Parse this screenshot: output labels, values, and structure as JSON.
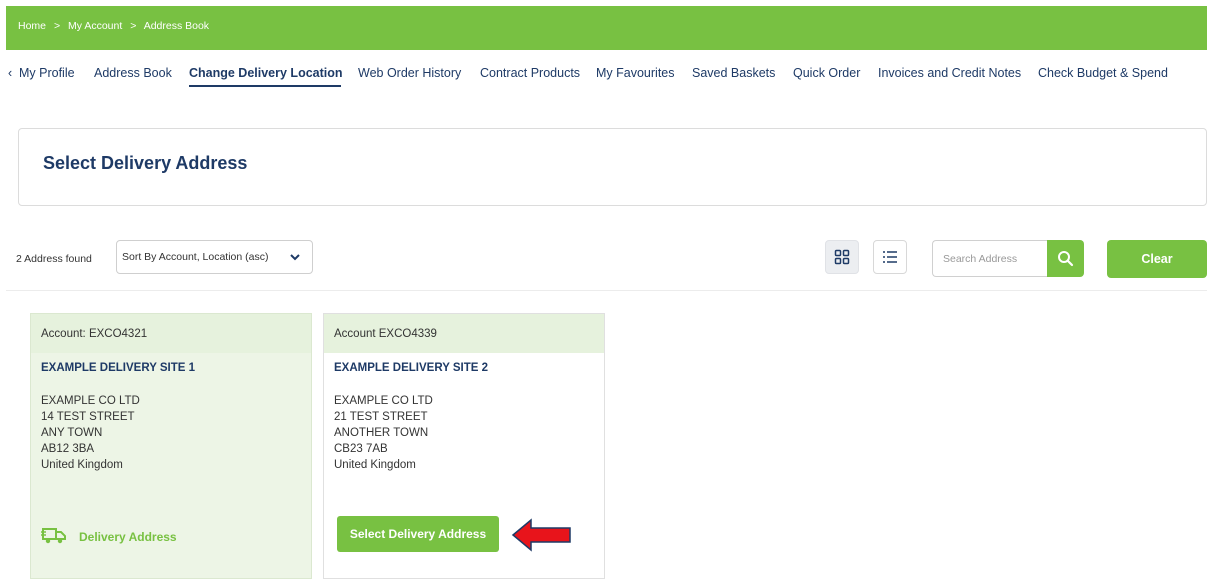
{
  "breadcrumb": {
    "items": [
      "Home",
      "My Account",
      "Address Book"
    ],
    "separator": ">"
  },
  "nav": {
    "prev_icon": "‹",
    "items": [
      "My Profile",
      "Address Book",
      "Change Delivery Location",
      "Web Order History",
      "Contract Products",
      "My Favourites",
      "Saved Baskets",
      "Quick Order",
      "Invoices and Credit Notes",
      "Check Budget & Spend"
    ],
    "active": "Change Delivery Location"
  },
  "panel": {
    "title": "Select Delivery Address"
  },
  "toolbar": {
    "count_text": "2 Address found",
    "sort_value": "Sort By Account, Location (asc)",
    "search_placeholder": "Search Address",
    "clear_label": "Clear"
  },
  "cards": [
    {
      "account": "Account:  EXCO4321",
      "site": "EXAMPLE DELIVERY SITE 1",
      "address": [
        "EXAMPLE CO LTD",
        "14 TEST STREET",
        "ANY TOWN",
        "AB12 3BA",
        "United Kingdom"
      ],
      "status": "Delivery Address"
    },
    {
      "account": "Account  EXCO4339",
      "site": "EXAMPLE DELIVERY SITE 2",
      "address": [
        "EXAMPLE CO LTD",
        "21 TEST STREET",
        "ANOTHER TOWN",
        "CB23 7AB",
        "United Kingdom"
      ],
      "action": "Select Delivery Address"
    }
  ],
  "colors": {
    "brand_green": "#78c142",
    "navy": "#1e3a66",
    "annotation_red": "#e8141b"
  }
}
